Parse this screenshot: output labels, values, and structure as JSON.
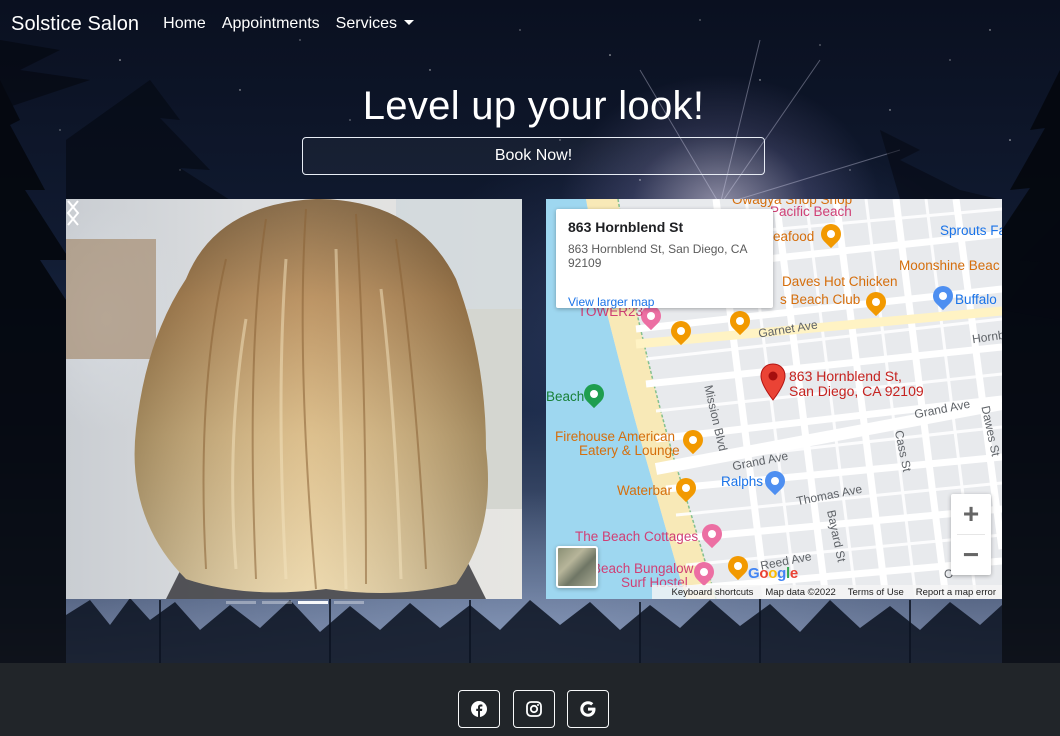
{
  "nav": {
    "brand": "Solstice Salon",
    "links": [
      "Home",
      "Appointments",
      "Services"
    ]
  },
  "hero": {
    "headline": "Level up your look!",
    "cta_label": "Book Now!"
  },
  "carousel": {
    "slide_count": 4,
    "active_index": 2
  },
  "map": {
    "info_title": "863 Hornblend St",
    "info_address": "863 Hornblend St, San Diego, CA 92109",
    "info_link": "View larger map",
    "marker_label_line1": "863 Hornblend St,",
    "marker_label_line2": "San Diego, CA 92109",
    "places": {
      "owagya": "Owagya Shop Shop",
      "pacific_beach": "Pacific Beach",
      "seafood": "eafood",
      "sprouts": "Sprouts Fa",
      "moonshine": "Moonshine Beac",
      "daves": "Daves Hot Chicken",
      "beach_club": "s Beach Club",
      "buffalo": "Buffalo",
      "tower23": "TOWER23",
      "beach": "Beach",
      "firehouse_1": "Firehouse American",
      "firehouse_2": "Eatery & Lounge",
      "waterbar": "Waterbar",
      "ralphs": "Ralphs",
      "beach_cottages": "The Beach Cottages",
      "bungalow_1": "Beach Bungalow",
      "bungalow_2": "Surf Hostel"
    },
    "streets": {
      "garnet": "Garnet Ave",
      "hornblend": "Hornb",
      "mission": "Mission Blvd",
      "grand_1": "Grand Ave",
      "grand_2": "Grand Ave",
      "cass": "Cass St",
      "dawes": "Dawes St",
      "thomas": "Thomas Ave",
      "bayard": "Bayard St",
      "reed": "Reed Ave",
      "oliver": "O"
    },
    "zoom_in": "+",
    "zoom_out": "−",
    "google": "Google",
    "attribution": {
      "shortcuts": "Keyboard shortcuts",
      "data": "Map data ©2022",
      "terms": "Terms of Use",
      "report": "Report a map error"
    }
  },
  "footer": {
    "social": [
      "facebook",
      "instagram",
      "google"
    ]
  },
  "colors": {
    "footer_bg": "#212529",
    "map_orange": "#f29900",
    "map_pink": "#ec6fa3",
    "map_blue": "#1a73e8",
    "marker_red": "#ea4335"
  }
}
